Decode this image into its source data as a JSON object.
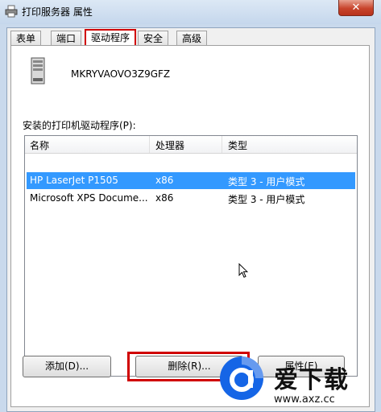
{
  "window": {
    "title": "打印服务器 属性",
    "close_label": "✕"
  },
  "tabs": [
    {
      "label": "表单"
    },
    {
      "label": "端口"
    },
    {
      "label": "驱动程序"
    },
    {
      "label": "安全"
    },
    {
      "label": "高级"
    }
  ],
  "active_tab": "驱动程序",
  "server": {
    "name": "MKRYVAOVO3Z9GFZ"
  },
  "drivers_label": "安装的打印机驱动程序(P):",
  "columns": [
    "名称",
    "处理器",
    "类型"
  ],
  "drivers": [
    {
      "name": "HP LaserJet P1505",
      "processor": "x86",
      "type": "类型 3 - 用户模式",
      "selected": true
    },
    {
      "name": "Microsoft XPS Docume...",
      "processor": "x86",
      "type": "类型 3 - 用户模式",
      "selected": false
    }
  ],
  "buttons": {
    "add": "添加(D)...",
    "remove": "删除(R)...",
    "properties": "属性(E)"
  },
  "watermark": {
    "text": "爱下载",
    "url": "www.axz.cc"
  },
  "colors": {
    "selection": "#3399ff",
    "highlight": "#d00000"
  }
}
